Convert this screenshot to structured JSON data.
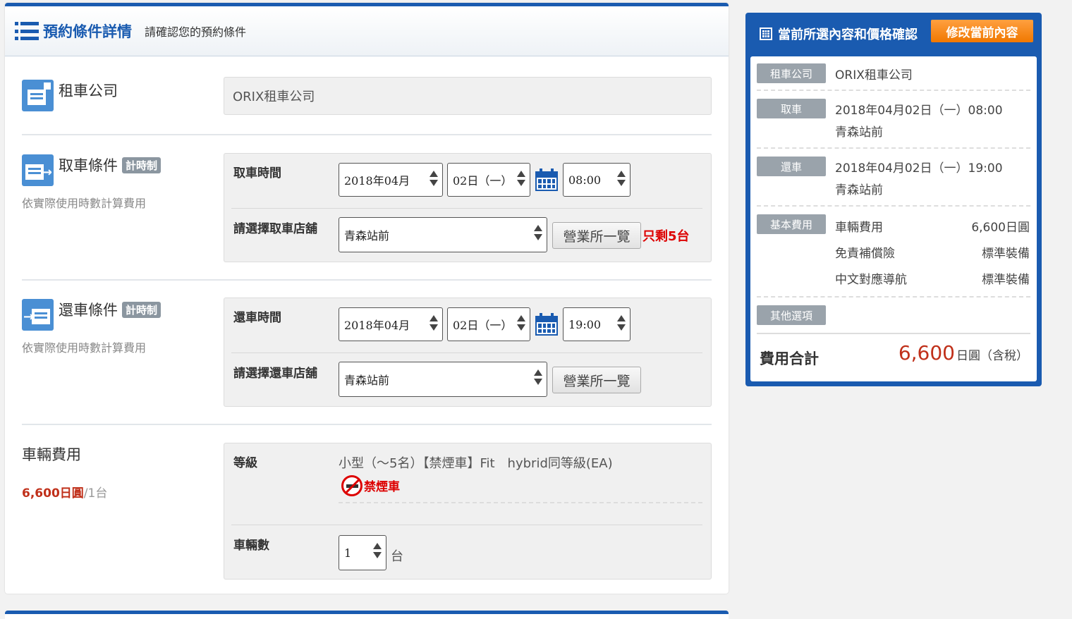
{
  "header": {
    "title": "預約條件詳情",
    "subtitle": "請確認您的預約條件"
  },
  "company": {
    "label": "租車公司",
    "value": "ORIX租車公司"
  },
  "pickup": {
    "title": "取車條件",
    "badge": "計時制",
    "desc": "依實際使用時數計算費用",
    "time_label": "取車時間",
    "month": "2018年04月",
    "day": "02日（一）",
    "time": "08:00",
    "store_label": "請選擇取車店舖",
    "store": "青森站前",
    "store_list_btn": "營業所一覽",
    "remaining": "只剩5台"
  },
  "return": {
    "title": "還車條件",
    "badge": "計時制",
    "desc": "依實際使用時數計算費用",
    "time_label": "還車時間",
    "month": "2018年04月",
    "day": "02日（一）",
    "time": "19:00",
    "store_label": "請選擇還車店舖",
    "store": "青森站前",
    "store_list_btn": "營業所一覽"
  },
  "vehicle": {
    "title": "車輛費用",
    "price": "6,600日圓",
    "per_unit": "/1台",
    "grade_label": "等級",
    "grade_value": "小型（～5名）【禁煙車】Fit　hybrid同等級(EA)",
    "nosmoke_label": "禁煙車",
    "count_label": "車輛數",
    "count_value": "1",
    "count_unit": "台"
  },
  "summary": {
    "title": "當前所選內容和價格確認",
    "modify_btn": "修改當前內容",
    "company_tag": "租車公司",
    "company_value": "ORIX租車公司",
    "pickup_tag": "取車",
    "pickup_datetime": "2018年04月02日（一）08:00",
    "pickup_store": "青森站前",
    "return_tag": "還車",
    "return_datetime": "2018年04月02日（一）19:00",
    "return_store": "青森站前",
    "basic_tag": "基本費用",
    "fees": [
      {
        "name": "車輛費用",
        "value": "6,600日圓"
      },
      {
        "name": "免責補償險",
        "value": "標準裝備"
      },
      {
        "name": "中文對應導航",
        "value": "標準裝備"
      }
    ],
    "other_tag": "其他選項",
    "total_label": "費用合計",
    "total_value": "6,600",
    "total_unit": "日圓（含稅）"
  },
  "colors": {
    "brand": "#1a5bb0",
    "accent_orange": "#f07800",
    "price_red": "#c0301a",
    "warn_red": "#dd0000"
  }
}
